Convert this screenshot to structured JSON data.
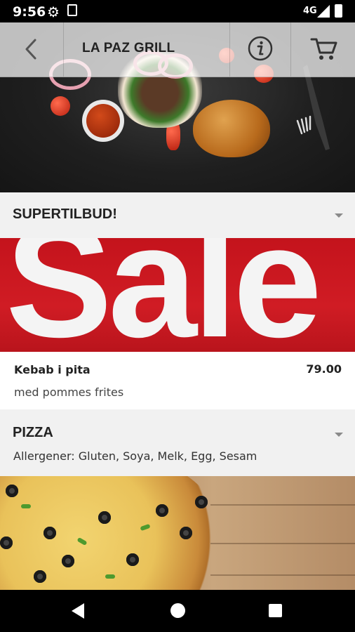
{
  "status_bar": {
    "time": "9:56",
    "network": "4G"
  },
  "header": {
    "title": "LA PAZ GRILL"
  },
  "sections": [
    {
      "title": "SUPERTILBUD!",
      "banner_text": "Sale",
      "items": [
        {
          "name": "Kebab i pita",
          "price": "79.00",
          "description": "med pommes frites"
        }
      ]
    },
    {
      "title": "PIZZA",
      "subtitle": "Allergener: Gluten, Soya, Melk, Egg, Sesam"
    }
  ],
  "icons": {
    "back": "arrow-left-icon",
    "info": "info-icon",
    "cart": "cart-icon",
    "expand": "caret-down-icon"
  }
}
